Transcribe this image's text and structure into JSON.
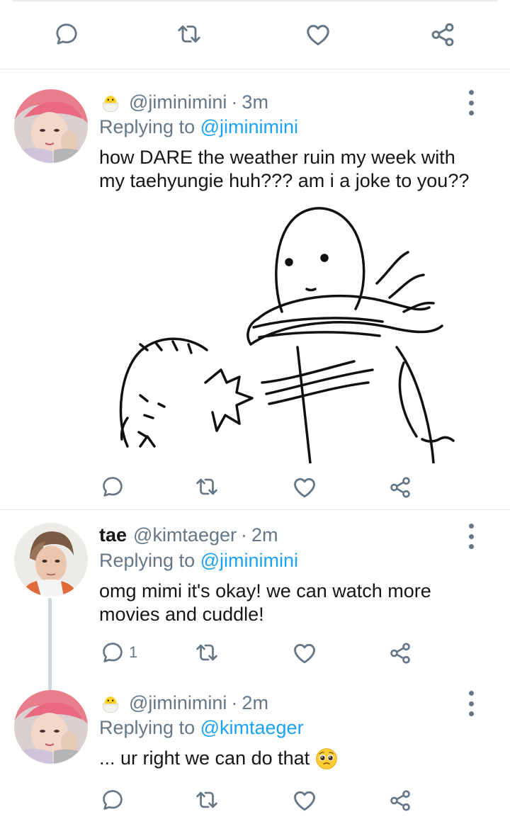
{
  "colors": {
    "text": "#14171a",
    "secondary": "#657786",
    "accent": "#1da1f2",
    "divider": "#e1e8ed",
    "thread_line": "#ccd6dd"
  },
  "top_actions": {
    "icons": [
      "reply-icon",
      "retweet-icon",
      "like-icon",
      "share-icon"
    ]
  },
  "tweets": [
    {
      "badge_icon": "hatching-chick-icon",
      "display_name": "",
      "handle": "@jiminimini",
      "separator": "·",
      "time": "3m",
      "replying_prefix": "Replying to",
      "replying_to": "@jiminimini",
      "text": "how DARE the weather ruin my week with my taehyungie huh??? am i a joke to you??",
      "media": "meme-image",
      "reply_count": ""
    },
    {
      "badge_icon": "",
      "display_name": "tae",
      "handle": "@kimtaeger",
      "separator": "·",
      "time": "2m",
      "replying_prefix": "Replying to",
      "replying_to": "@jiminimini",
      "text": "omg mimi it's okay! we can watch more movies and cuddle!",
      "reply_count": "1"
    },
    {
      "badge_icon": "hatching-chick-icon",
      "display_name": "",
      "handle": "@jiminimini",
      "separator": "·",
      "time": "2m",
      "replying_prefix": "Replying to",
      "replying_to": "@kimtaeger",
      "text": "... ur right we can do that",
      "trailing_emoji": "pleading-face-icon",
      "reply_count": ""
    }
  ]
}
